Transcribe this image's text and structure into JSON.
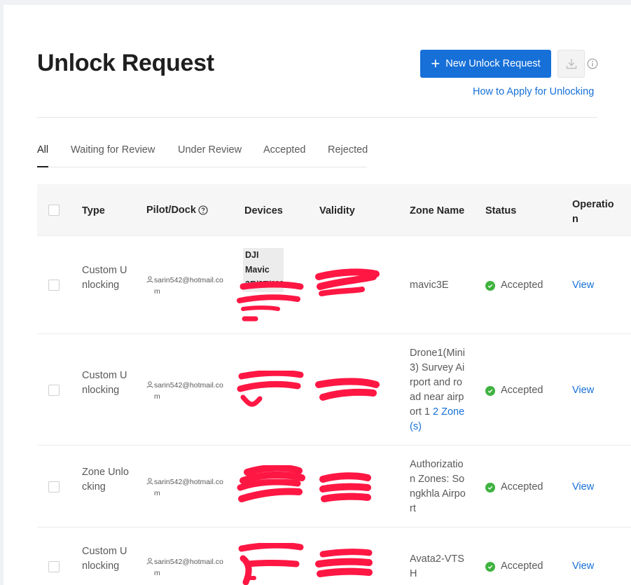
{
  "page": {
    "title": "Unlock Request",
    "new_button_label": "New Unlock Request",
    "howto_link": "How to Apply for Unlocking"
  },
  "tabs": [
    {
      "label": "All",
      "active": true
    },
    {
      "label": "Waiting for Review",
      "active": false
    },
    {
      "label": "Under Review",
      "active": false
    },
    {
      "label": "Accepted",
      "active": false
    },
    {
      "label": "Rejected",
      "active": false
    }
  ],
  "table": {
    "headers": {
      "type": "Type",
      "pilot": "Pilot/Dock",
      "devices": "Devices",
      "validity": "Validity",
      "zone_name": "Zone Name",
      "status": "Status",
      "operation": "Operation"
    },
    "rows": [
      {
        "type": "Custom Unlocking",
        "pilot": "sarin542@hotmail.com",
        "device_tag": "DJI Mavic 3E/3T/3M",
        "zone_name": "mavic3E",
        "zone_link": "",
        "status": "Accepted",
        "operation": "View"
      },
      {
        "type": "Custom Unlocking",
        "pilot": "sarin542@hotmail.com",
        "device_tag": "",
        "zone_name": "Drone1(Mini3) Survey Airport and road near airport 1",
        "zone_link": "2 Zone(s)",
        "status": "Accepted",
        "operation": "View"
      },
      {
        "type": "Zone Unlocking",
        "pilot": "sarin542@hotmail.com",
        "device_tag": "",
        "zone_name": "Authorization Zones: Songkhla Airport",
        "zone_link": "",
        "status": "Accepted",
        "operation": "View"
      },
      {
        "type": "Custom Unlocking",
        "pilot": "sarin542@hotmail.com",
        "device_tag": "",
        "zone_name": "Avata2-VTSH",
        "zone_link": "",
        "status": "Accepted",
        "operation": "View"
      }
    ]
  },
  "colors": {
    "accent": "#1670d8",
    "success": "#3fb23f",
    "redaction": "#ff1744"
  },
  "icons": {
    "plus": "plus-icon",
    "download": "download-icon",
    "info": "info-icon",
    "help": "question-circle-icon",
    "person": "person-icon",
    "check": "check-circle-icon"
  }
}
